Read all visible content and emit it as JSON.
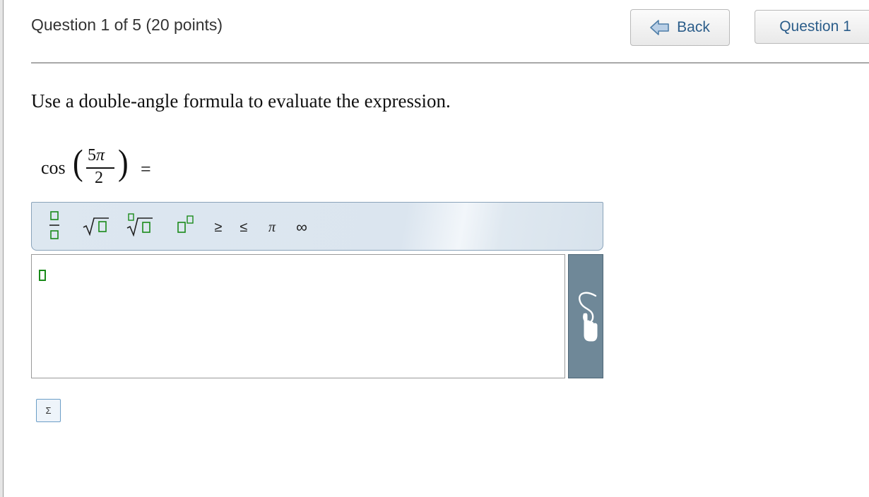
{
  "header": {
    "question_status": "Question 1 of 5 (20 points)",
    "back_label": "Back",
    "question_nav_label": "Question 1"
  },
  "question": {
    "prompt": "Use a double-angle formula to evaluate the expression.",
    "function": "cos",
    "numerator_coef": "5",
    "numerator_symbol": "π",
    "denominator": "2",
    "equals": "="
  },
  "toolbar": {
    "greater_equal": "≥",
    "less_equal": "≤",
    "pi": "π",
    "infinity": "∞"
  },
  "answer_tools": {
    "sigma": "Σ"
  },
  "colors": {
    "toolbar_bg": "#dbe5ef",
    "handwriting_panel": "#6f8898",
    "cursor": "#1a8a1a",
    "link_text": "#2b5d8a"
  }
}
